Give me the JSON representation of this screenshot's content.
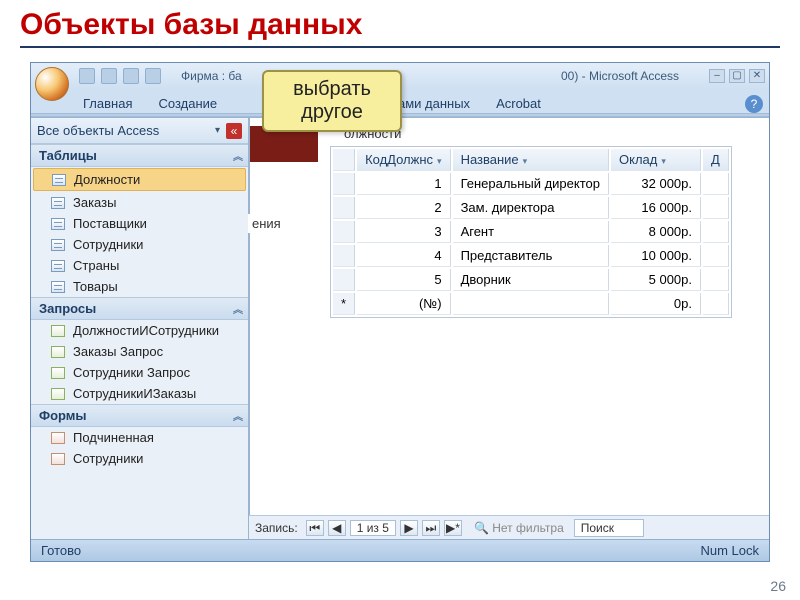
{
  "slide": {
    "title": "Объекты базы данных",
    "page_number": "26"
  },
  "callout": {
    "line1": "выбрать",
    "line2": "другое"
  },
  "window": {
    "title_fragment_left": "Фирма : ба",
    "title_fragment_right": "00) - Microsoft Access",
    "tabs": {
      "home": "Главная",
      "create": "Создание",
      "db_tools_frag": "базами данных",
      "acrobat": "Acrobat"
    }
  },
  "navpane": {
    "header": "Все объекты Access",
    "groups": {
      "tables": {
        "label": "Таблицы",
        "items": [
          "Должности",
          "Заказы",
          "Поставщики",
          "Сотрудники",
          "Страны",
          "Товары"
        ]
      },
      "queries": {
        "label": "Запросы",
        "items": [
          "ДолжностиИСотрудники",
          "Заказы Запрос",
          "Сотрудники Запрос",
          "СотрудникиИЗаказы"
        ]
      },
      "forms": {
        "label": "Формы",
        "items": [
          "Подчиненная",
          "Сотрудники"
        ]
      }
    }
  },
  "doc": {
    "tab_label_frag": "олжности",
    "peek_text": "ения",
    "columns": {
      "id": "КодДолжнс",
      "name": "Название",
      "salary": "Оклад",
      "extra": "Д"
    },
    "rows": [
      {
        "id": "1",
        "name": "Генеральный директор",
        "salary": "32 000р."
      },
      {
        "id": "2",
        "name": "Зам. директора",
        "salary": "16 000р."
      },
      {
        "id": "3",
        "name": "Агент",
        "salary": "8 000р."
      },
      {
        "id": "4",
        "name": "Представитель",
        "salary": "10 000р."
      },
      {
        "id": "5",
        "name": "Дворник",
        "salary": "5 000р."
      }
    ],
    "new_row": {
      "id": "(№)",
      "salary": "0р."
    }
  },
  "recnav": {
    "label": "Запись:",
    "position": "1 из 5",
    "filter": "Нет фильтра",
    "search": "Поиск"
  },
  "statusbar": {
    "left": "Готово",
    "right": "Num Lock"
  },
  "chart_data": {
    "type": "table",
    "title": "Должности",
    "columns": [
      "КодДолжнс",
      "Название",
      "Оклад"
    ],
    "rows": [
      [
        1,
        "Генеральный директор",
        32000
      ],
      [
        2,
        "Зам. директора",
        16000
      ],
      [
        3,
        "Агент",
        8000
      ],
      [
        4,
        "Представитель",
        10000
      ],
      [
        5,
        "Дворник",
        5000
      ]
    ],
    "currency": "р."
  }
}
